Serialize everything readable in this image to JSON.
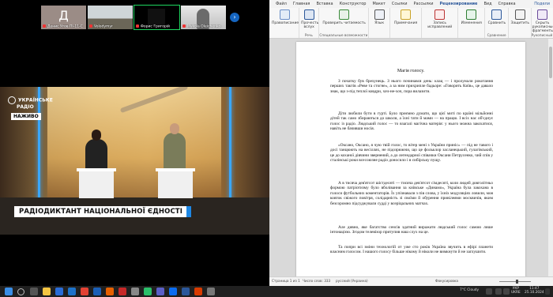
{
  "call": {
    "participants": [
      {
        "label": "Денис Угов ПІ-11-С",
        "initial": "Д",
        "muted": true
      },
      {
        "label": "Volodymyr",
        "initial": "",
        "muted": true
      },
      {
        "label": "Форис Григорій",
        "initial": "",
        "muted": true
      },
      {
        "label": "Mykola Oleichenko",
        "initial": "",
        "muted": true
      }
    ],
    "next_icon": "chevron-right-icon",
    "video": {
      "logo_line1": "УКРАЇНСЬКЕ",
      "logo_line2": "РАДІО",
      "live_badge": "НАЖИВО",
      "banner": "РАДІОДИКТАНТ НАЦІОНАЛЬНОЇ ЄДНОСТІ"
    }
  },
  "word": {
    "menu": [
      "Файл",
      "Главная",
      "Вставка",
      "Конструктор",
      "Макет",
      "Ссылки",
      "Рассылки",
      "Рецензирование",
      "Вид",
      "Справка"
    ],
    "active_menu": "Рецензирование",
    "share_label": "Подели",
    "ribbon": {
      "buttons": [
        {
          "label": "Правописание",
          "group": "Правописание"
        },
        {
          "label": "Прочесть вслух",
          "group": "Речь"
        },
        {
          "label": "Проверить читаемость",
          "group": "Специальные возможности"
        },
        {
          "label": "Язык",
          "group": "Язык"
        },
        {
          "label": "Примечания",
          "group": "Примечания"
        },
        {
          "label": "Запись исправлений",
          "group": "Запись исправлений"
        },
        {
          "label": "Изменения",
          "group": "Изменения"
        },
        {
          "label": "Сравнить",
          "group": "Сравнение"
        },
        {
          "label": "Защитить",
          "group": "Защита"
        },
        {
          "label": "Скрыть рукописные фрагменты",
          "group": "Рукописный ввод"
        }
      ],
      "group_labels": {
        "speech": "Речь",
        "access": "Специальные возможности",
        "compare": "Сравнение",
        "ink": "Рукописный ввод"
      }
    },
    "document": {
      "title": "Магія голосу.",
      "paragraphs": [
        "З початку був брехунець. З нього починався день: клац — і пролунали рокотання перших тактів «Реве та стогне», а за ним прихрипле бадьоре: «Говорить Київ», це давало знак, що з-під теплої ковдри, хоч-не-хоч, пора вилазити.",
        "Діти любили бути в гурті. Було приємно думати, що цієї миті по країні мільйонні дітей так само збираються до школи, а їхні тати й мами — на працю. І всіх нас об'єднує голос із радіо. Людський голос — то взагалі магічна матерія: у нього можна закохатися, навіть не бачивши носія.",
        "«Оксано, Оксано, я чую твій голос, то вітер мені з України приніс» — під не тавого і досі танцюють на весіллях, не підозрюючи, що це фольклор засланецький, гулагівський, це до коханої дівчини звернений, а до легендарної співачки Оксани Петрусенко, чий спів у сталінські роки всесоюзне радіо доносило і в сибірську пущу.",
        "А в тисяча дев'ятсот шістдесяті — тисяча дев'ятсот сімдесяті, коли людей довголітньо формою патріотизму було вболівання за київське «Динамо», Україна була закохана в голоси футбольних коментаторів. Їх упізнавали з пів слова, у їхніх модуляціях ловили, моя ковток свіжого повітря, солідарність зі своїми й обурення привілеями москвичів, яким безсоромно підсуджували судді у всеріцальних матчах.",
        "Але дивно, яке багатство сенсів здатний виражати людський голос самою лише інтонацією. Згодом телевізор притупив наш слух на це.",
        "Та попри всі зміни технологій от уже сто років Україна звучить в ефірі планети власним голосом. І нашого голосу більше нікому й ніколи не вимкнути й не заглушити."
      ]
    },
    "status": {
      "page": "Страница 1 из 1",
      "words": "Число слов: 333",
      "language": "русский (Украина)",
      "focus": "Фокусировка"
    }
  },
  "taskbar": {
    "weather": "7°C Cloudy",
    "lang_top": "УКР",
    "lang_bottom": "UKRE",
    "time": "11:47",
    "date": "25.10.2024"
  },
  "colors": {
    "word_accent": "#2b579a",
    "active_speaker": "#1ed760",
    "banner_accent": "#1e88e5"
  }
}
